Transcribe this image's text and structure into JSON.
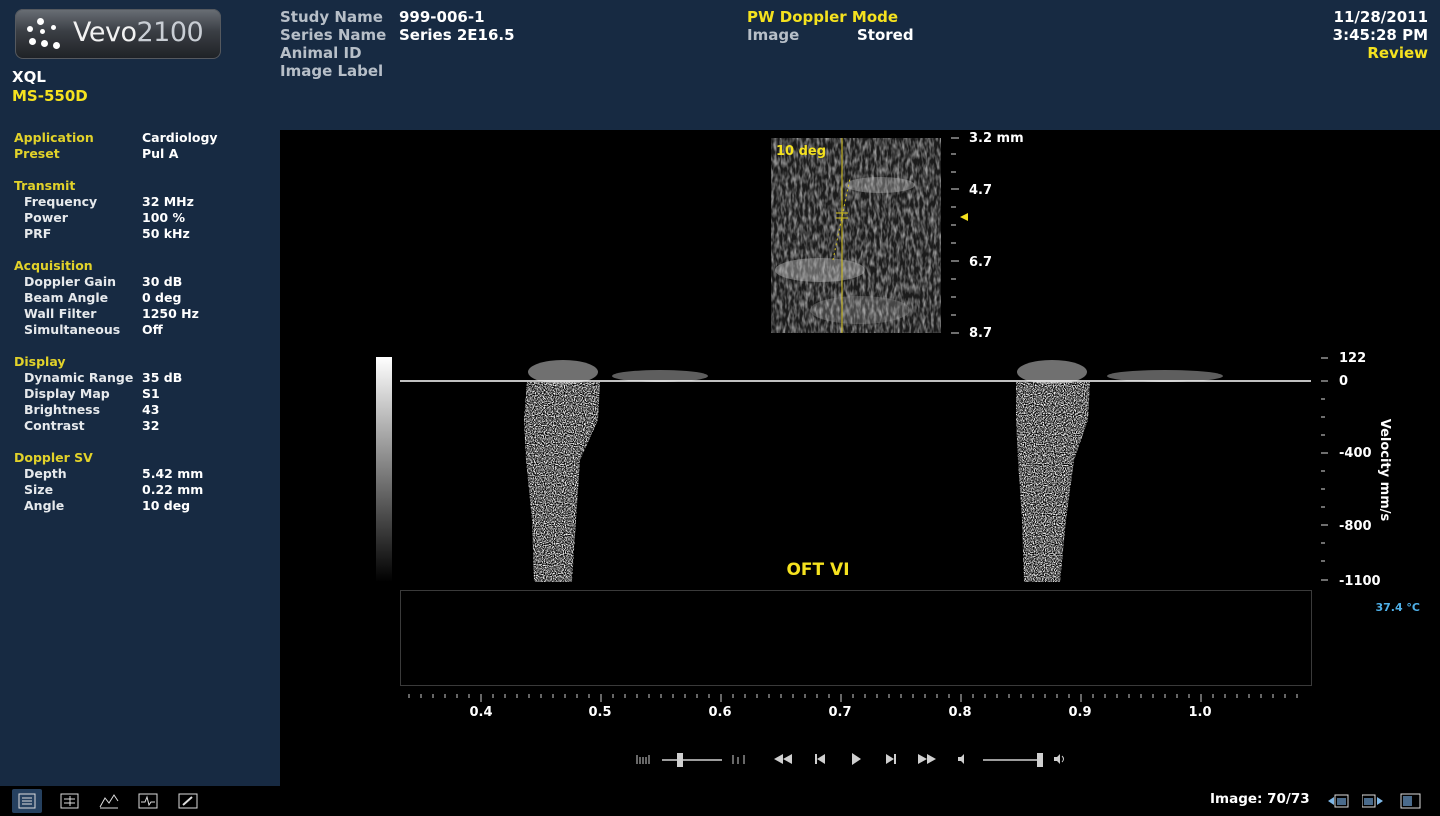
{
  "brand": {
    "name": "Vevo",
    "model": "2100"
  },
  "system": {
    "name": "XQL",
    "probe": "MS-550D"
  },
  "header": {
    "study_name_label": "Study Name",
    "study_name_value": "999-006-1",
    "series_name_label": "Series Name",
    "series_name_value": "Series 2E16.5",
    "animal_id_label": "Animal ID",
    "image_label_label": "Image Label",
    "mode": "PW Doppler Mode",
    "image_label": "Image",
    "image_value": "Stored",
    "date": "11/28/2011",
    "time": "3:45:28 PM",
    "review": "Review"
  },
  "sidebar": {
    "application_label": "Application",
    "application_value": "Cardiology",
    "preset_label": "Preset",
    "preset_value": "Pul A",
    "transmit_heading": "Transmit",
    "transmit": [
      {
        "label": "Frequency",
        "value": "32 MHz"
      },
      {
        "label": "Power",
        "value": "100 %"
      },
      {
        "label": "PRF",
        "value": "50 kHz"
      }
    ],
    "acquisition_heading": "Acquisition",
    "acquisition": [
      {
        "label": "Doppler Gain",
        "value": "30 dB"
      },
      {
        "label": "Beam Angle",
        "value": "0 deg"
      },
      {
        "label": "Wall Filter",
        "value": "1250 Hz"
      },
      {
        "label": "Simultaneous",
        "value": "Off"
      }
    ],
    "display_heading": "Display",
    "display": [
      {
        "label": "Dynamic Range",
        "value": "35 dB"
      },
      {
        "label": "Display Map",
        "value": "S1"
      },
      {
        "label": "Brightness",
        "value": "43"
      },
      {
        "label": "Contrast",
        "value": "32"
      }
    ],
    "doppler_sv_heading": "Doppler SV",
    "doppler_sv": [
      {
        "label": "Depth",
        "value": "5.42 mm"
      },
      {
        "label": "Size",
        "value": "0.22 mm"
      },
      {
        "label": "Angle",
        "value": "10 deg"
      }
    ]
  },
  "bmode": {
    "angle_label": "10 deg",
    "depth_ticks": [
      "3.2 mm",
      "4.7",
      "6.7",
      "8.7"
    ]
  },
  "doppler": {
    "annotation": "OFT VI",
    "velocity_axis_label": "Velocity mm/s",
    "velocity_ticks": [
      "122",
      "0",
      "-400",
      "-800",
      "-1100"
    ],
    "time_ticks": [
      "0.4",
      "0.5",
      "0.6",
      "0.7",
      "0.8",
      "0.9",
      "1.0"
    ],
    "temperature": "37.4 °C"
  },
  "controls": {
    "speed_slider": 0.3,
    "volume_slider": 1.0
  },
  "footer": {
    "image_counter": "Image: 70/73"
  },
  "icons": {
    "sidebar_toggle": "list-icon",
    "measure": "measurement-icon",
    "analysis": "analysis-icon",
    "physio": "physio-icon",
    "tools": "tools-icon",
    "prev_image": "previous-image-icon",
    "next_image": "next-image-icon",
    "layout": "layout-icon"
  },
  "colors": {
    "panel": "#172a42",
    "accent": "#f5e21f",
    "temperature": "#4fb0e8"
  }
}
